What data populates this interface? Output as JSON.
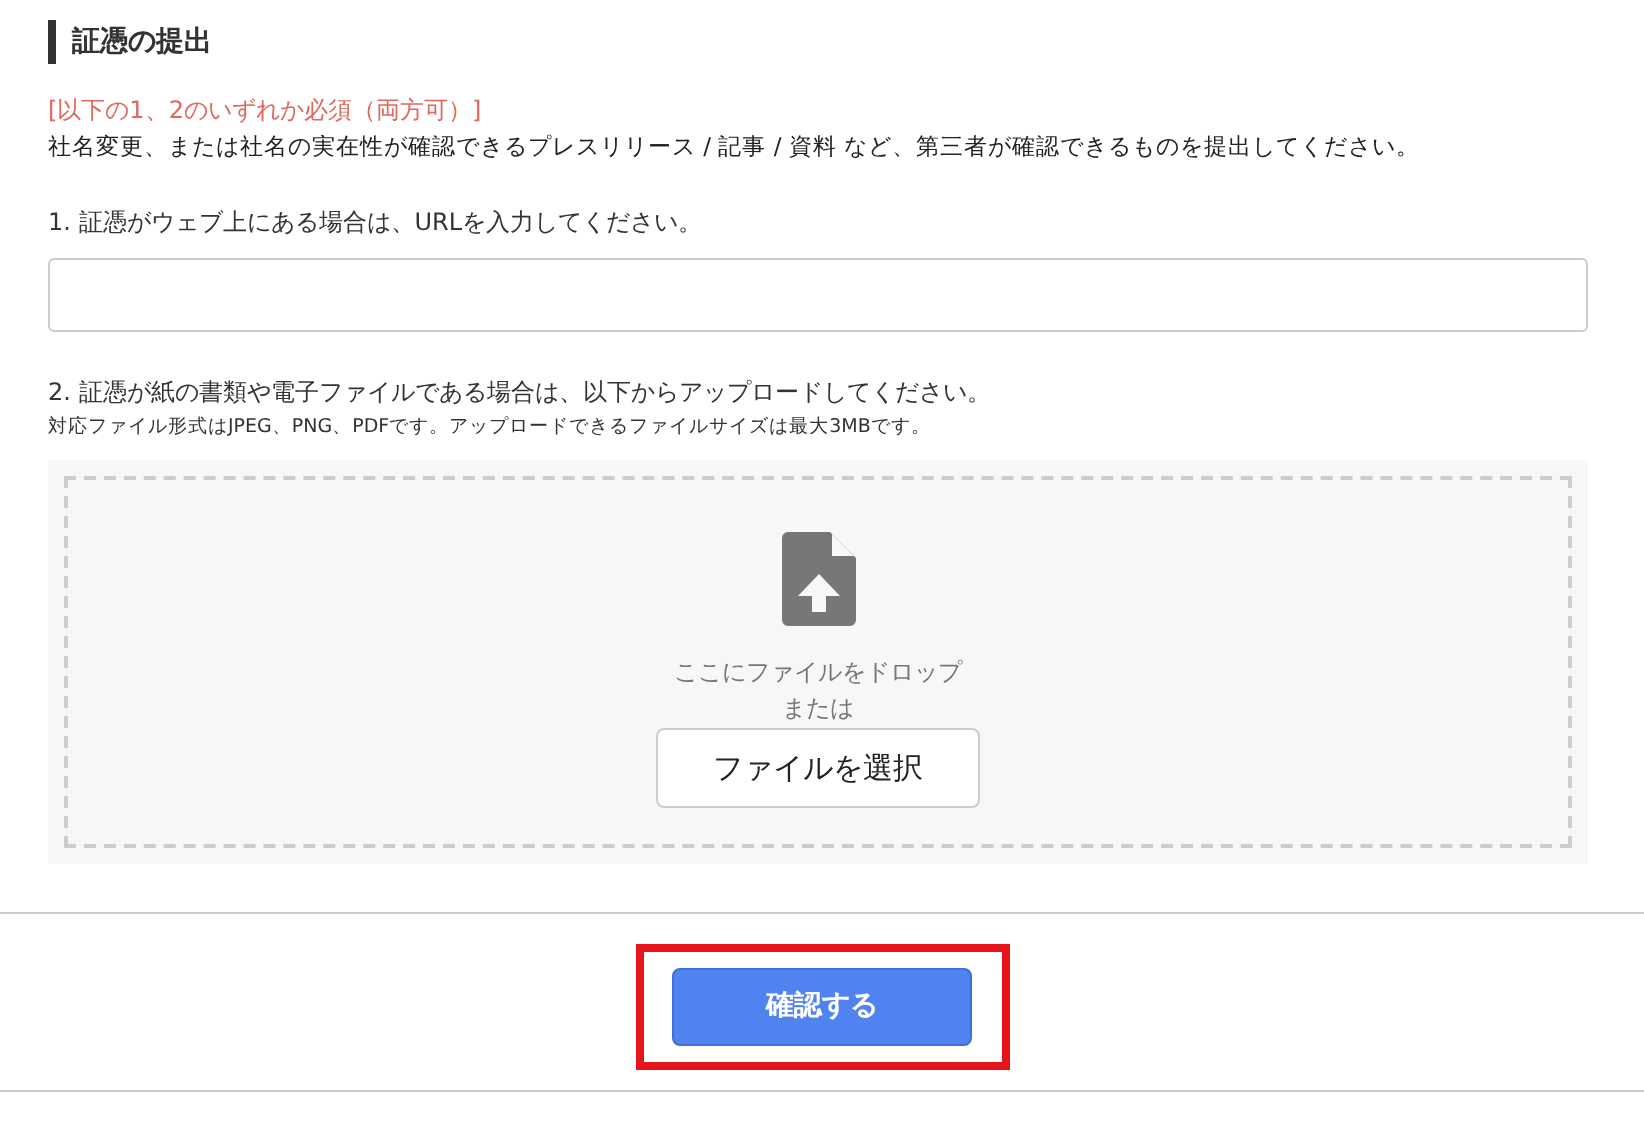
{
  "section": {
    "title": "証憑の提出",
    "requirement": "[以下の1、2のいずれか必須（両方可）]",
    "description": "社名変更、または社名の実在性が確認できるプレスリリース / 記事 / 資料 など、第三者が確認できるものを提出してください。"
  },
  "url_option": {
    "label": "1. 証憑がウェブ上にある場合は、URLを入力してください。"
  },
  "upload_option": {
    "label": "2. 証憑が紙の書類や電子ファイルである場合は、以下からアップロードしてください。",
    "note": "対応ファイル形式はJPEG、PNG、PDFです。アップロードできるファイルサイズは最大3MBです。",
    "drop_text": "ここにファイルをドロップ",
    "or_text": "または",
    "select_button": "ファイルを選択"
  },
  "submit": {
    "label": "確認する",
    "highlighted": true
  }
}
